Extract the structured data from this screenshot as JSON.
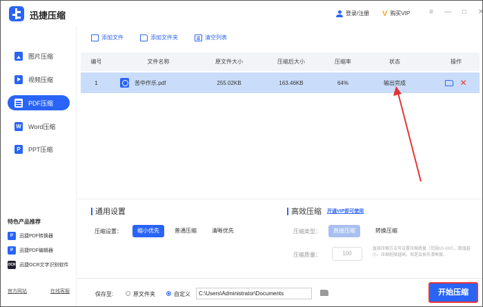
{
  "app": {
    "title": "迅捷压缩",
    "login_label": "登录/注册",
    "vip_label": "购买VIP",
    "win_controls": {
      "menu": "≡",
      "minimize": "—",
      "maximize": "□",
      "close": "✕"
    }
  },
  "sidebar": {
    "items": [
      {
        "label": "图片压缩",
        "icon": "image-icon",
        "active": false
      },
      {
        "label": "视频压缩",
        "icon": "video-icon",
        "active": false
      },
      {
        "label": "PDF压缩",
        "icon": "pdf-icon",
        "active": true
      },
      {
        "label": "Word压缩",
        "icon": "word-icon",
        "active": false
      },
      {
        "label": "PPT压缩",
        "icon": "ppt-icon",
        "active": false
      }
    ],
    "word_icon_text": "W",
    "ppt_icon_text": "P",
    "featured_title": "特色产品推荐",
    "featured": [
      {
        "label": "迅捷PDF转换器",
        "icon_text": "P"
      },
      {
        "label": "迅捷PDF编辑器",
        "icon_text": "P"
      },
      {
        "label": "迅捷OCR文字识别软件",
        "icon_text": "OCR"
      }
    ],
    "links": {
      "website": "官方网站",
      "service": "在线客服"
    }
  },
  "toolbar": {
    "add_file": "添加文件",
    "add_folder": "添加文件夹",
    "clear_list": "清空列表"
  },
  "table": {
    "headers": [
      "编号",
      "文件名称",
      "原文件大小",
      "压缩后大小",
      "压缩率",
      "状态",
      "操作"
    ],
    "rows": [
      {
        "index": "1",
        "name": "苦中作乐.pdf",
        "original_size": "255.02KB",
        "compressed_size": "163.46KB",
        "ratio": "64%",
        "status": "输出完成"
      }
    ]
  },
  "settings": {
    "general_title": "通用设置",
    "compress_label": "压缩设置：",
    "options": [
      "缩小优先",
      "普通压缩",
      "清晰优先"
    ],
    "selected_option": "缩小优先",
    "advanced_title": "高效压缩",
    "vip_link": "开通VIP即可使用",
    "type_label": "压缩类型：",
    "type_options": [
      "直接压缩",
      "转换压缩"
    ],
    "quality_label": "压缩质量：",
    "quality_value": "100",
    "hint": "直接压缩方法可设置压缩质量（范围10-100），数值越小，压缩程度越高，但是会损失清晰度。"
  },
  "footer": {
    "save_to_label": "保存至:",
    "opt_original": "原文件夹",
    "opt_custom": "自定义",
    "selected": "自定义",
    "path": "C:\\Users\\Administrator\\Documents",
    "start_button": "开始压缩"
  },
  "colors": {
    "accent": "#2a64f6",
    "selected_row": "#c9ddfa",
    "annotation": "#e33333"
  }
}
